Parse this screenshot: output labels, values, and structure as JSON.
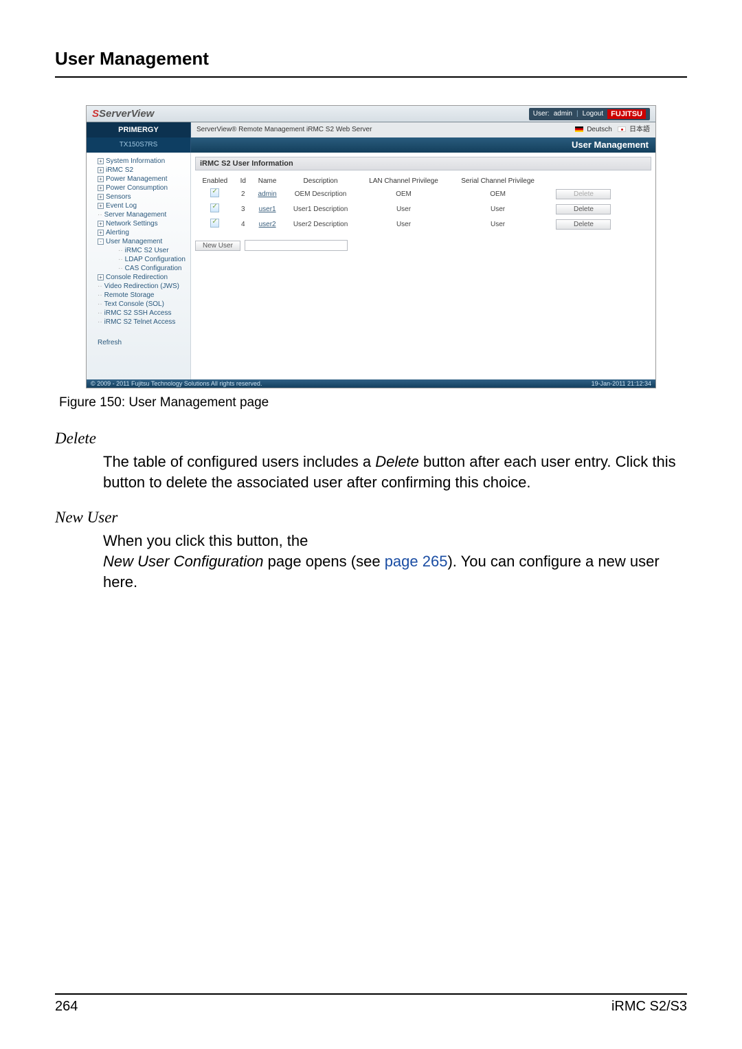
{
  "page": {
    "title": "User Management",
    "figure_caption": "Figure 150: User Management page",
    "page_number": "264",
    "doc_label": "iRMC S2/S3"
  },
  "topbar": {
    "logo": "ServerView",
    "user_prefix": "User:",
    "user": "admin",
    "logout": "Logout",
    "brand": "FUJITSU"
  },
  "secondbar": {
    "primergy": "PRIMERGY",
    "breadcrumb": "ServerView® Remote Management iRMC S2 Web Server",
    "lang_de": "Deutsch",
    "lang_jp": "日本語"
  },
  "thirdbar": {
    "server": "TX150S7RS",
    "section": "User Management"
  },
  "sidebar": {
    "items": [
      {
        "label": "System Information",
        "exp": "+"
      },
      {
        "label": "iRMC S2",
        "exp": "+"
      },
      {
        "label": "Power Management",
        "exp": "+"
      },
      {
        "label": "Power Consumption",
        "exp": "+"
      },
      {
        "label": "Sensors",
        "exp": "+"
      },
      {
        "label": "Event Log",
        "exp": "+"
      },
      {
        "label": "Server Management",
        "exp": ""
      },
      {
        "label": "Network Settings",
        "exp": "+"
      },
      {
        "label": "Alerting",
        "exp": "+"
      },
      {
        "label": "User Management",
        "exp": "-"
      }
    ],
    "um_children": [
      "iRMC S2 User",
      "LDAP Configuration",
      "CAS Configuration"
    ],
    "tail_items": [
      {
        "label": "Console Redirection",
        "exp": "+"
      },
      {
        "label": "Video Redirection (JWS)",
        "exp": ""
      },
      {
        "label": "Remote Storage",
        "exp": ""
      },
      {
        "label": "Text Console (SOL)",
        "exp": ""
      },
      {
        "label": "iRMC S2 SSH Access",
        "exp": ""
      },
      {
        "label": "iRMC S2 Telnet Access",
        "exp": ""
      }
    ],
    "refresh": "Refresh"
  },
  "panel": {
    "title": "iRMC S2 User Information",
    "cols": [
      "Enabled",
      "Id",
      "Name",
      "Description",
      "LAN Channel Privilege",
      "Serial Channel Privilege",
      ""
    ],
    "rows": [
      {
        "id": "2",
        "name": "admin",
        "desc": "OEM  Description",
        "lan": "OEM",
        "serial": "OEM",
        "btn": "Delete",
        "disabled": true
      },
      {
        "id": "3",
        "name": "user1",
        "desc": "User1 Description",
        "lan": "User",
        "serial": "User",
        "btn": "Delete",
        "disabled": false
      },
      {
        "id": "4",
        "name": "user2",
        "desc": "User2 Description",
        "lan": "User",
        "serial": "User",
        "btn": "Delete",
        "disabled": false
      }
    ],
    "newuser_btn": "New User"
  },
  "footerbar": {
    "left": "© 2009 - 2011 Fujitsu Technology Solutions  All rights reserved.",
    "right": "19-Jan-2011 21:12:34"
  },
  "body": {
    "delete_term": "Delete",
    "delete_text_a": "The table of configured users includes a ",
    "delete_text_b": "Delete",
    "delete_text_c": " button after each user entry. Click this button to delete the associated user after confirming this choice.",
    "newuser_term": "New User",
    "newuser_line1": "When you click this button, the",
    "newuser_line2a": "New User Configuration",
    "newuser_line2b": " page opens (see ",
    "newuser_link": "page 265",
    "newuser_line2c": "). You can configure a new user here."
  }
}
